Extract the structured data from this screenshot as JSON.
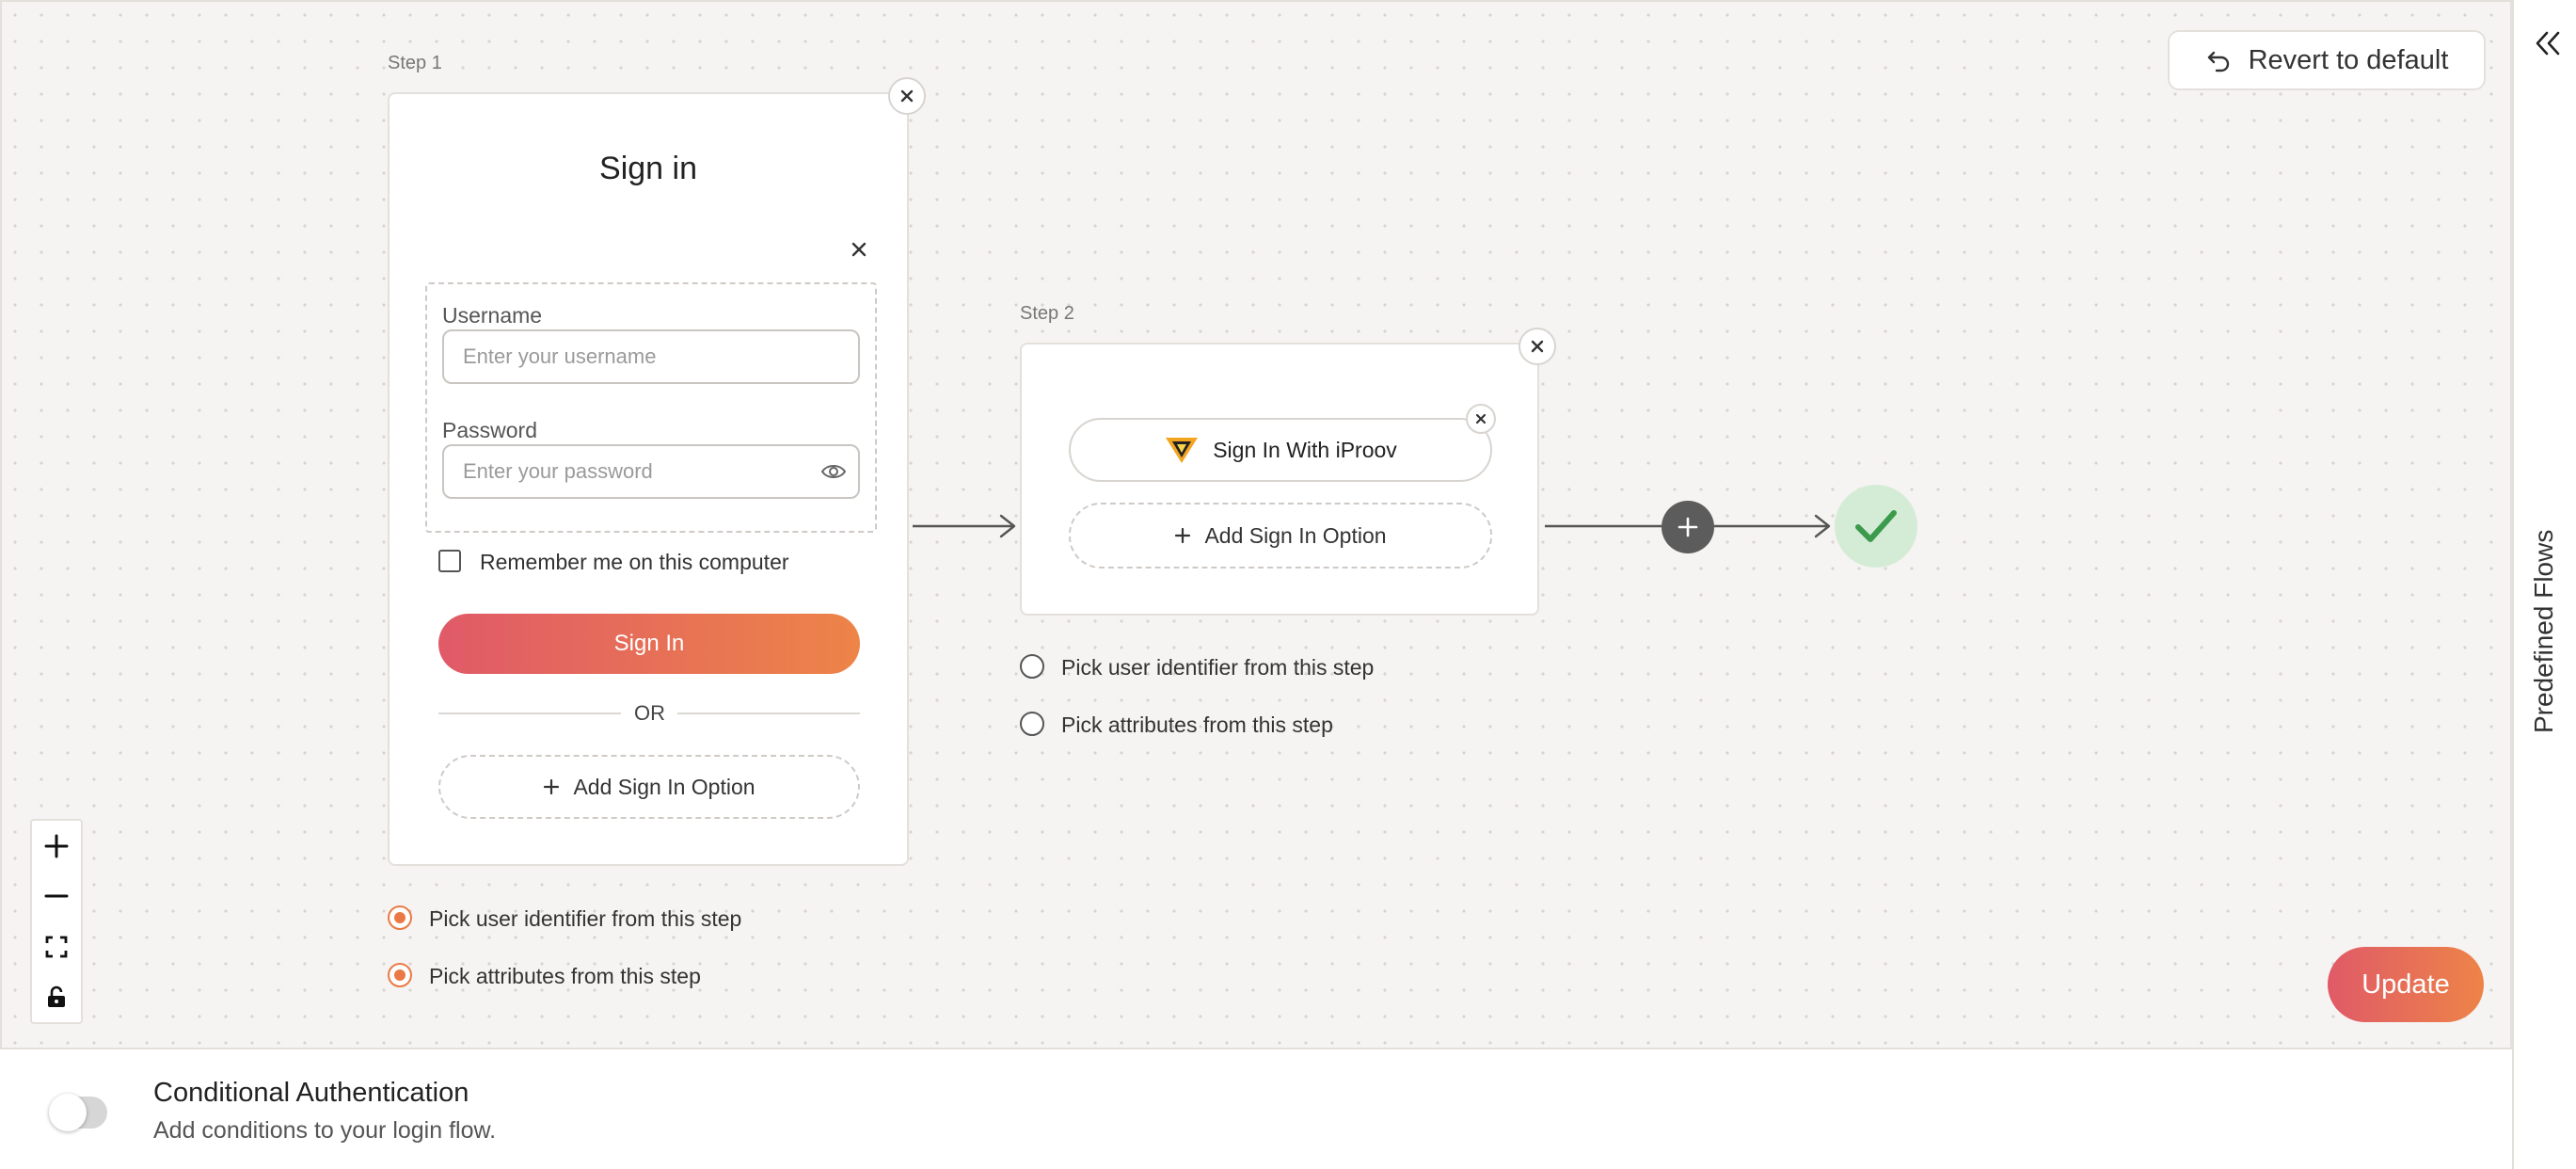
{
  "header": {
    "revert_label": "Revert to default"
  },
  "side_panel": {
    "label": "Predefined Flows",
    "collapse_icon": "double-chevron-left-icon"
  },
  "step1": {
    "label": "Step 1",
    "title": "Sign in",
    "username_label": "Username",
    "username_placeholder": "Enter your username",
    "password_label": "Password",
    "password_placeholder": "Enter your password",
    "remember_label": "Remember me on this computer",
    "signin_label": "Sign In",
    "or_label": "OR",
    "add_option_label": "Add Sign In Option",
    "pick_identifier_label": "Pick user identifier from this step",
    "pick_attributes_label": "Pick attributes from this step",
    "pick_identifier_selected": true,
    "pick_attributes_selected": true
  },
  "step2": {
    "label": "Step 2",
    "provider_label": "Sign In With iProov",
    "add_option_label": "Add Sign In Option",
    "pick_identifier_label": "Pick user identifier from this step",
    "pick_attributes_label": "Pick attributes from this step",
    "pick_identifier_selected": false,
    "pick_attributes_selected": false
  },
  "actions": {
    "update_label": "Update"
  },
  "conditional": {
    "title": "Conditional Authentication",
    "subtitle": "Add conditions to your login flow.",
    "enabled": false
  },
  "colors": {
    "accent_start": "#e05a68",
    "accent_end": "#ed8448",
    "radio_selected": "#ea7a45",
    "success_bg": "#d4ecd6",
    "success_check": "#3c9a4c"
  }
}
